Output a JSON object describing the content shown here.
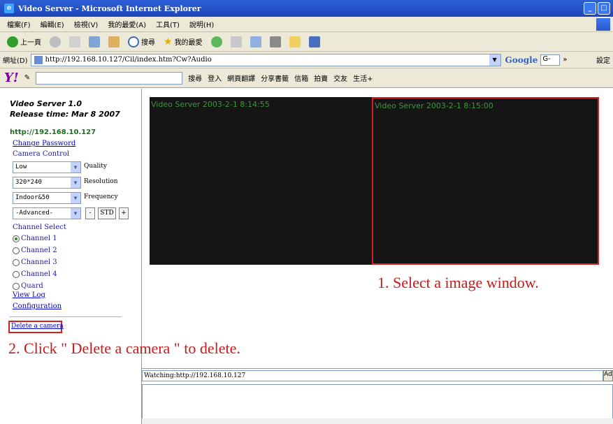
{
  "window": {
    "title": "Video Server - Microsoft Internet Explorer",
    "min": "_",
    "max": "□"
  },
  "menu": [
    "檔案(F)",
    "編輯(E)",
    "檢視(V)",
    "我的最愛(A)",
    "工具(T)",
    "說明(H)"
  ],
  "toolbar": {
    "back": "上一頁",
    "search": "搜尋",
    "favorites": "我的最愛"
  },
  "address": {
    "label": "網址(D)",
    "url": "http://192.168.10.127/Cil/index.htm?Cw?Audio",
    "google_label": "Google",
    "google_box": "G-",
    "more": "»",
    "settings": "設定"
  },
  "yahoo": {
    "logo": "Y!",
    "items": [
      "搜尋",
      "登入",
      "網頁翻譯",
      "分享書籤",
      "信箱",
      "拍賣",
      "交友",
      "生活+"
    ]
  },
  "left": {
    "title_line1": "Video Server 1.0",
    "title_line2": "Release time: Mar 8 2007",
    "server_url": "http://192.168.10.127",
    "change_password": "Change Password",
    "camera_control": "Camera Control",
    "selects": [
      {
        "value": "Low",
        "label": "Quality"
      },
      {
        "value": "320*240",
        "label": "Resolution"
      },
      {
        "value": "Indoor&50",
        "label": "Frequency"
      },
      {
        "value": "-Advanced-",
        "label": ""
      }
    ],
    "btn_minus": "-",
    "btn_std": "STD",
    "btn_plus": "+",
    "channel_select": "Channel Select",
    "channels": [
      "Channel 1",
      "Channel 2",
      "Channel 3",
      "Channel 4",
      "Quard"
    ],
    "selected_channel": "Channel 1",
    "view_log": "View Log",
    "configuration": "Configuration",
    "delete_camera": "Delete a camera"
  },
  "videos": [
    {
      "osd": "Video Server  2003-2-1  8:14:55",
      "selected": false
    },
    {
      "osd": "Video Server  2003-2-1  8:15:00",
      "selected": true
    }
  ],
  "annotations": {
    "step1": "1. Select a image window.",
    "step2": "2. Click \" Delete a camera \" to delete."
  },
  "bottom": {
    "watching_label": "Watching:",
    "watching_url": "http://192.168.10.127",
    "ad": "Ad"
  },
  "colors": {
    "accent_red": "#d32020",
    "titlebar_blue": "#2d5fd6",
    "osd_green": "#3d963d"
  }
}
